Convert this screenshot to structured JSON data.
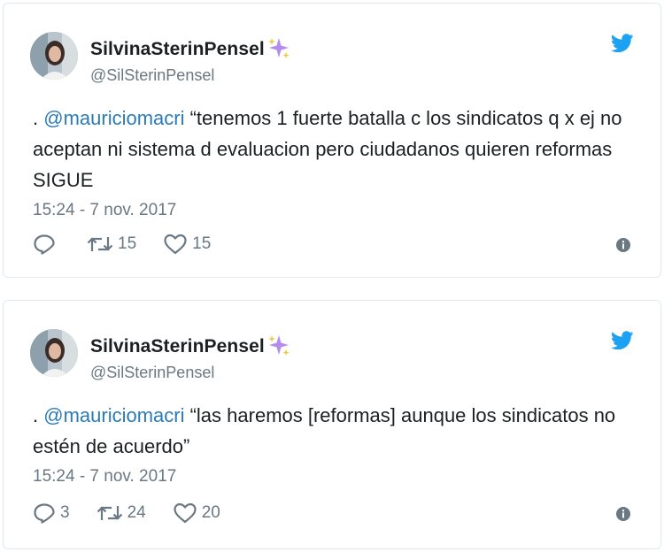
{
  "tweets": [
    {
      "author_name": "SilvinaSterinPensel",
      "handle": "@SilSterinPensel",
      "text_prefix": ". ",
      "mention": "@mauriciomacri",
      "text_body": " “tenemos 1 fuerte batalla c los sindicatos q x ej no aceptan ni sistema d evaluacion pero ciudadanos quieren reformas SIGUE",
      "timestamp": "15:24 - 7 nov. 2017",
      "reply_count": "",
      "retweet_count": "15",
      "like_count": "15",
      "icons": {
        "brand": "twitter-bird-icon",
        "emoji": "sparkles-icon",
        "reply": "reply-icon",
        "retweet": "retweet-icon",
        "like": "heart-icon",
        "info": "info-icon"
      }
    },
    {
      "author_name": "SilvinaSterinPensel",
      "handle": "@SilSterinPensel",
      "text_prefix": ". ",
      "mention": "@mauriciomacri",
      "text_body": " “las haremos [reformas] aunque los sindicatos no estén de acuerdo”",
      "timestamp": "15:24 - 7 nov. 2017",
      "reply_count": "3",
      "retweet_count": "24",
      "like_count": "20",
      "icons": {
        "brand": "twitter-bird-icon",
        "emoji": "sparkles-icon",
        "reply": "reply-icon",
        "retweet": "retweet-icon",
        "like": "heart-icon",
        "info": "info-icon"
      }
    }
  ],
  "colors": {
    "link": "#2b7bb9",
    "muted": "#697882",
    "brand": "#1da1f2",
    "text": "#1c2022",
    "border": "#e1e8ed"
  }
}
